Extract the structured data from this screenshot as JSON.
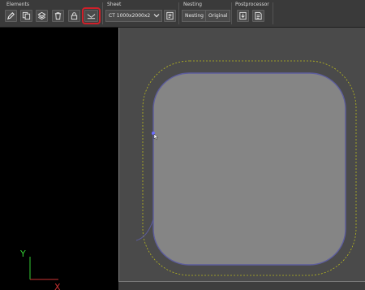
{
  "toolbar": {
    "elements": {
      "title": "Elements",
      "buttons": [
        {
          "name": "edit-button",
          "icon": "pencil-icon"
        },
        {
          "name": "copy-button",
          "icon": "copy-icon"
        },
        {
          "name": "layers-button",
          "icon": "layers-icon"
        },
        {
          "name": "delete-button",
          "icon": "trash-icon"
        },
        {
          "name": "lock-button",
          "icon": "lock-icon"
        },
        {
          "name": "lead-in-button",
          "icon": "lead-in-icon",
          "highlighted": true
        }
      ]
    },
    "sheet": {
      "title": "Sheet",
      "selected_value": "CT 1000x2000x2",
      "extra_button_icon": "sheet-icon"
    },
    "nesting": {
      "title": "Nesting",
      "nesting_label": "Nesting",
      "original_label": "Original"
    },
    "postprocessor": {
      "title": "Postprocessor",
      "buttons": [
        {
          "name": "export-button",
          "icon": "export-icon"
        },
        {
          "name": "report-button",
          "icon": "report-icon"
        }
      ]
    }
  },
  "axes": {
    "y_label": "Y",
    "x_label": "X"
  },
  "colors": {
    "part_fill": "#858585",
    "contour": "#5c5c9c",
    "offset_dashed": "#b8b81e",
    "highlight": "#d0202a",
    "axis_y": "#33cc33",
    "axis_x": "#cc3333"
  }
}
